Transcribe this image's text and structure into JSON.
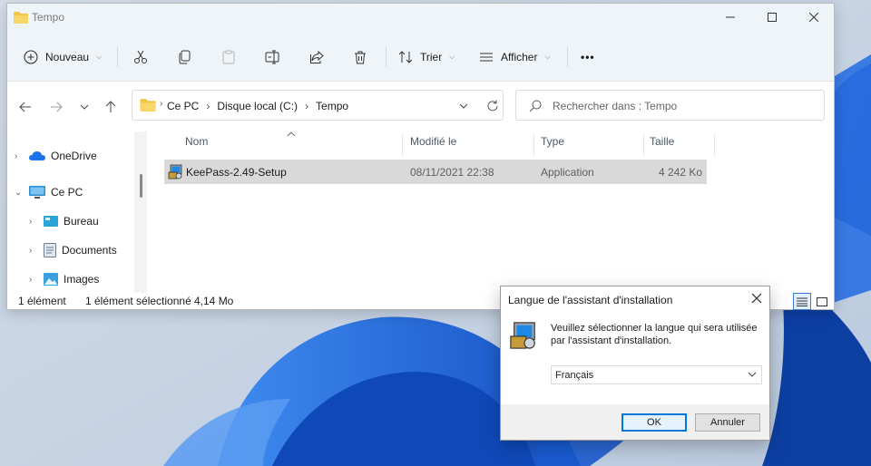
{
  "explorer": {
    "title": "Tempo",
    "toolbar": {
      "new_label": "Nouveau",
      "sort_label": "Trier",
      "view_label": "Afficher",
      "more_label": "•••"
    },
    "address": {
      "crumbs": [
        "Ce PC",
        "Disque local (C:)",
        "Tempo"
      ]
    },
    "search": {
      "placeholder": "Rechercher dans : Tempo"
    },
    "sidebar": {
      "items": [
        {
          "label": "OneDrive",
          "icon": "cloud-icon"
        },
        {
          "label": "Ce PC",
          "icon": "computer-icon"
        },
        {
          "label": "Bureau",
          "icon": "desktop-icon"
        },
        {
          "label": "Documents",
          "icon": "document-icon"
        },
        {
          "label": "Images",
          "icon": "image-icon"
        }
      ]
    },
    "columns": [
      "Nom",
      "Modifié le",
      "Type",
      "Taille"
    ],
    "files": [
      {
        "name": "KeePass-2.49-Setup",
        "modified": "08/11/2021 22:38",
        "type": "Application",
        "size": "4 242 Ko"
      }
    ],
    "status": {
      "count": "1 élément",
      "selected": "1 élément sélectionné",
      "size": "4,14 Mo"
    }
  },
  "dialog": {
    "title": "Langue de l'assistant d'installation",
    "message": "Veuillez sélectionner la langue qui sera utilisée par l'assistant d'installation.",
    "language": "Français",
    "ok_label": "OK",
    "cancel_label": "Annuler"
  },
  "colors": {
    "accent": "#0078d7",
    "selection": "#d9d9d9",
    "titlebar": "#eff4f8"
  }
}
